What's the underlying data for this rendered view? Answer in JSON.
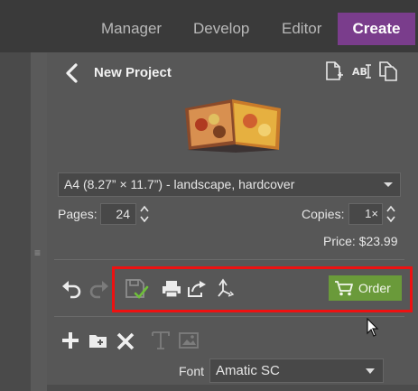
{
  "top_nav": {
    "tabs": [
      {
        "label": "Manager"
      },
      {
        "label": "Develop"
      },
      {
        "label": "Editor"
      },
      {
        "label": "Create",
        "active": true
      }
    ],
    "active_color": "#7a3d8c"
  },
  "project": {
    "title": "New Project"
  },
  "format": {
    "selected": "A4 (8.27” × 11.7”) - landscape, hardcover"
  },
  "pages": {
    "label": "Pages:",
    "value": "24"
  },
  "copies": {
    "label": "Copies:",
    "value": "1×"
  },
  "price": {
    "text": "Price: $23.99"
  },
  "toolbar": {
    "order_label": "Order",
    "order_color": "#6a9a3a",
    "highlight_color": "#ee1111"
  },
  "font": {
    "label": "Font",
    "value": "Amatic SC"
  },
  "icons": {
    "back": "chevron-left-icon",
    "new_page": "new-page-icon",
    "rename": "rename-icon",
    "copy": "copy-icon",
    "undo": "undo-icon",
    "redo": "redo-icon",
    "save": "save-icon",
    "print": "print-icon",
    "share": "share-icon",
    "export": "export-icon",
    "cart": "cart-icon",
    "add": "plus-icon",
    "add_folder": "add-folder-icon",
    "delete": "close-icon",
    "text": "text-icon",
    "image": "image-icon"
  }
}
